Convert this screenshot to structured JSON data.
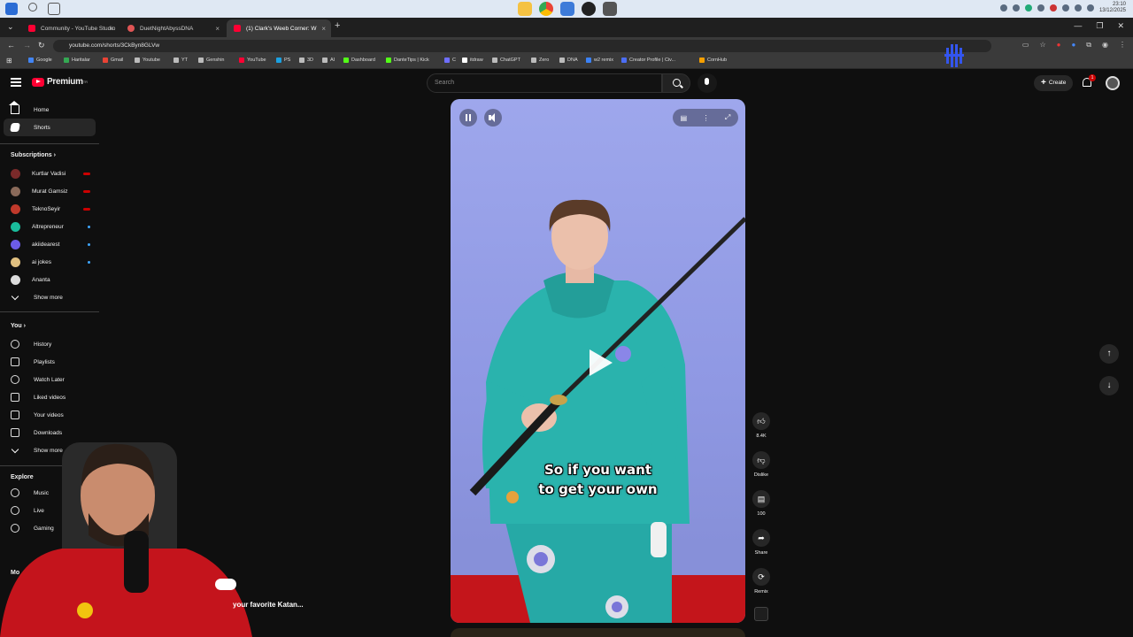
{
  "browser": {
    "tabs": [
      {
        "title": "Community - YouTube Studio",
        "color": "#ff0033"
      },
      {
        "title": "DuetNightAbyssDNA",
        "color": "#e05555"
      },
      {
        "title": "(1) Clark's Weeb Corner: W",
        "color": "#ff0033"
      }
    ],
    "url": "youtube.com/shorts/3CkByn8GLVw",
    "clock_time": "23:10",
    "clock_date": "13/12/2025",
    "bookmarks": [
      {
        "label": "Google",
        "color": "#4285f4"
      },
      {
        "label": "Haritalar",
        "color": "#34a853"
      },
      {
        "label": "Gmail",
        "color": "#ea4335"
      },
      {
        "label": "Youtube",
        "color": "#bbbbbb"
      },
      {
        "label": "YT",
        "color": "#bbbbbb"
      },
      {
        "label": "Genshin",
        "color": "#bbbbbb"
      },
      {
        "label": "YouTube",
        "color": "#ff0033"
      },
      {
        "label": "PS",
        "color": "#1ba1e2"
      },
      {
        "label": "3D",
        "color": "#bbbbbb"
      },
      {
        "label": "AI",
        "color": "#bbbbbb"
      },
      {
        "label": "Dashboard",
        "color": "#53fc18"
      },
      {
        "label": "DanteTips | Kick",
        "color": "#53fc18"
      },
      {
        "label": "C",
        "color": "#6f6fff"
      },
      {
        "label": "itdraw",
        "color": "#ffffff"
      },
      {
        "label": "ChatGPT",
        "color": "#bbbbbb"
      },
      {
        "label": "Zero",
        "color": "#bbbbbb"
      },
      {
        "label": "DNA",
        "color": "#bbbbbb"
      },
      {
        "label": "w2 remix",
        "color": "#3b82f6"
      },
      {
        "label": "Creator Profile | Civ...",
        "color": "#4c6ef5"
      },
      {
        "label": "CornHub",
        "color": "#f59f00"
      }
    ]
  },
  "header": {
    "logo_text": "Premium",
    "logo_tm": "TR",
    "search_placeholder": "Search",
    "create_label": "Create",
    "notif_count": "1"
  },
  "sidebar": {
    "main": [
      {
        "label": "Home"
      },
      {
        "label": "Shorts"
      }
    ],
    "subscriptions_heading": "Subscriptions",
    "subscriptions": [
      {
        "label": "Kurtlar Vadisi",
        "color": "#7a2a2a",
        "badge": "live"
      },
      {
        "label": "Murat Gamsiz",
        "color": "#8a6a5a",
        "badge": "live"
      },
      {
        "label": "TeknoSeyir",
        "color": "#c0392b",
        "badge": "live"
      },
      {
        "label": "Altrepreneur",
        "color": "#1abc9c",
        "badge": "dot"
      },
      {
        "label": "akiidearest",
        "color": "#6c5ce7",
        "badge": "dot"
      },
      {
        "label": "ai jokes",
        "color": "#e0c080",
        "badge": "dot"
      },
      {
        "label": "Ananta",
        "color": "#dddddd",
        "badge": ""
      }
    ],
    "subs_show_more": "Show more",
    "you_heading": "You",
    "you_items": [
      {
        "label": "History"
      },
      {
        "label": "Playlists"
      },
      {
        "label": "Watch Later"
      },
      {
        "label": "Liked videos"
      },
      {
        "label": "Your videos"
      },
      {
        "label": "Downloads"
      }
    ],
    "you_show_more": "Show more",
    "explore_heading": "Explore",
    "explore_items": [
      {
        "label": "Music"
      },
      {
        "label": "Live"
      },
      {
        "label": "Gaming"
      }
    ],
    "more_heading": "Mo"
  },
  "video": {
    "caption_line1": "So if you want",
    "caption_line2": "to get your own",
    "title": "your favorite Katan..."
  },
  "actions": {
    "like_count": "8.4K",
    "dislike_label": "Dislike",
    "comment_count": "100",
    "share_label": "Share",
    "remix_label": "Remix"
  },
  "colors": {
    "background": "#0f0f0f",
    "accent": "#ff0033",
    "video_bg": "#9ea7ec"
  }
}
